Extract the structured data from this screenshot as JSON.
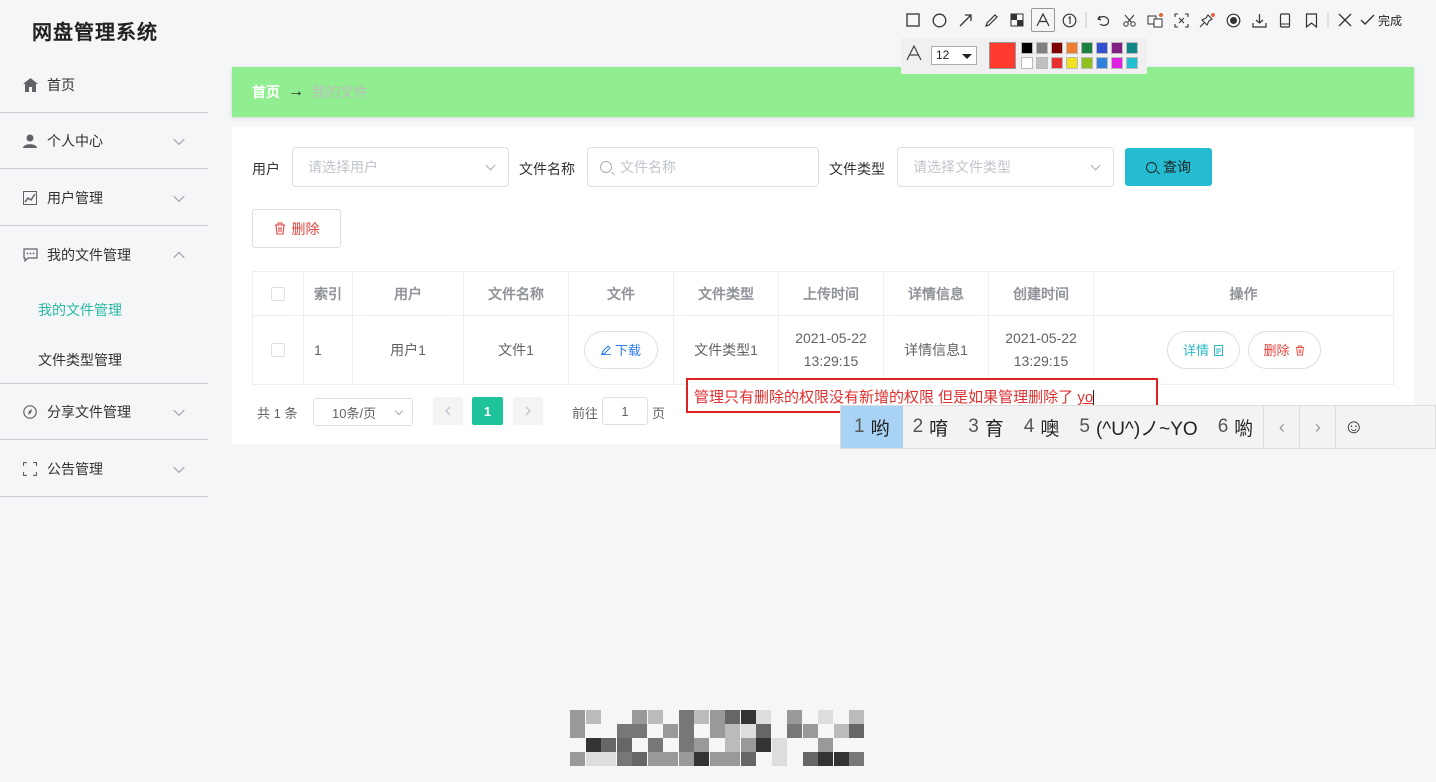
{
  "app": {
    "title": "网盘管理系统"
  },
  "sidebar": {
    "items": [
      {
        "label": "首页",
        "icon": "home-icon"
      },
      {
        "label": "个人中心",
        "icon": "user-icon"
      },
      {
        "label": "用户管理",
        "icon": "chart-icon"
      },
      {
        "label": "我的文件管理",
        "icon": "message-icon"
      },
      {
        "label": "分享文件管理",
        "icon": "compass-icon"
      },
      {
        "label": "公告管理",
        "icon": "fullscreen-icon"
      }
    ],
    "subitems": [
      {
        "label": "我的文件管理",
        "active": true
      },
      {
        "label": "文件类型管理",
        "active": false
      }
    ]
  },
  "breadcrumb": {
    "home": "首页",
    "arrow": "→",
    "current": "我的文件"
  },
  "filters": {
    "user_label": "用户",
    "user_placeholder": "请选择用户",
    "filename_label": "文件名称",
    "filename_placeholder": "文件名称",
    "filetype_label": "文件类型",
    "filetype_placeholder": "请选择文件类型",
    "query_label": "查询",
    "delete_label": "删除"
  },
  "table": {
    "headers": [
      "索引",
      "用户",
      "文件名称",
      "文件",
      "文件类型",
      "上传时间",
      "详情信息",
      "创建时间",
      "操作"
    ],
    "rows": [
      {
        "index": "1",
        "user": "用户1",
        "filename": "文件1",
        "download": "下载",
        "filetype": "文件类型1",
        "upload_date": "2021-05-22",
        "upload_time": "13:29:15",
        "detail": "详情信息1",
        "create_date": "2021-05-22",
        "create_time": "13:29:15",
        "detail_btn": "详情",
        "delete_btn": "删除"
      }
    ]
  },
  "pagination": {
    "total": "共 1 条",
    "page_size": "10条/页",
    "current_page": "1",
    "goto_label": "前往",
    "goto_value": "1",
    "page_suffix": "页"
  },
  "screenshot_tool": {
    "done_label": "完成",
    "font_size": "12",
    "current_color": "#ff3b30",
    "palette_top": [
      "#000000",
      "#808080",
      "#800000",
      "#f08030",
      "#208040",
      "#3050d0",
      "#802080",
      "#108888"
    ],
    "palette_bottom": [
      "#ffffff",
      "#c0c0c0",
      "#e83030",
      "#f0e020",
      "#90c020",
      "#3080e0",
      "#e020e0",
      "#20c0d0"
    ]
  },
  "annotation": {
    "text": "管理只有删除的权限没有新增的权限 但是如果管理删除了 ",
    "pinyin": "yo"
  },
  "ime": {
    "candidates": [
      {
        "n": "1",
        "text": "哟"
      },
      {
        "n": "2",
        "text": "唷"
      },
      {
        "n": "3",
        "text": "育"
      },
      {
        "n": "4",
        "text": "噢"
      },
      {
        "n": "5",
        "text": "(^U^)ノ~YO"
      },
      {
        "n": "6",
        "text": "喲"
      }
    ],
    "prev": "‹",
    "next": "›",
    "emoji": "☺"
  }
}
